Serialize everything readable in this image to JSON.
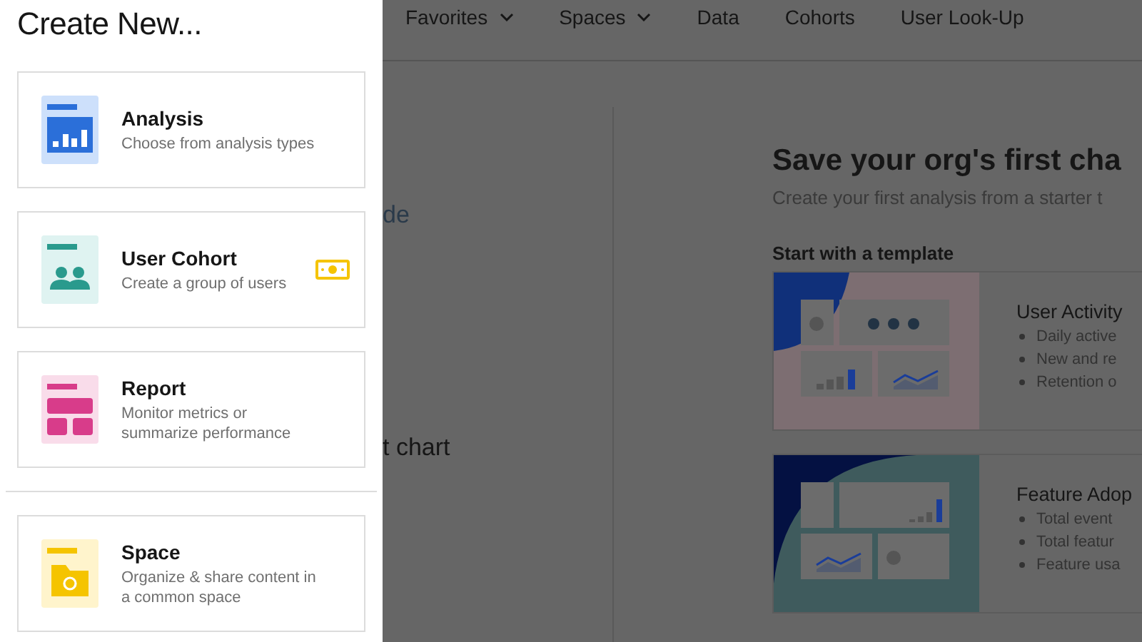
{
  "drawer": {
    "title": "Create New...",
    "items": [
      {
        "kind": "analysis",
        "title": "Analysis",
        "description": "Choose from analysis types",
        "premium": false
      },
      {
        "kind": "cohort",
        "title": "User Cohort",
        "description": "Create a group of users",
        "premium": true
      },
      {
        "kind": "report",
        "title": "Report",
        "description": "Monitor metrics or summarize performance",
        "premium": false
      }
    ],
    "footer_items": [
      {
        "kind": "space",
        "title": "Space",
        "description": "Organize & share content in a common space",
        "premium": false
      }
    ]
  },
  "nav": {
    "items": [
      {
        "label": "Favorites",
        "dropdown": true
      },
      {
        "label": "Spaces",
        "dropdown": true
      },
      {
        "label": "Data",
        "dropdown": false
      },
      {
        "label": "Cohorts",
        "dropdown": false
      },
      {
        "label": "User Look-Up",
        "dropdown": false
      }
    ]
  },
  "left_column": {
    "texts": [
      "de",
      "t chart"
    ]
  },
  "hero": {
    "title": "Save your org's first cha",
    "subtitle": "Create your first analysis from a starter t",
    "templates_heading": "Start with a template"
  },
  "templates": [
    {
      "kind": "activity",
      "title": "User Activity",
      "bullets": [
        "Daily active",
        "New and re",
        "Retention o"
      ]
    },
    {
      "kind": "adoption",
      "title": "Feature Adop",
      "bullets": [
        "Total event",
        "Total featur",
        "Feature usa"
      ]
    }
  ]
}
